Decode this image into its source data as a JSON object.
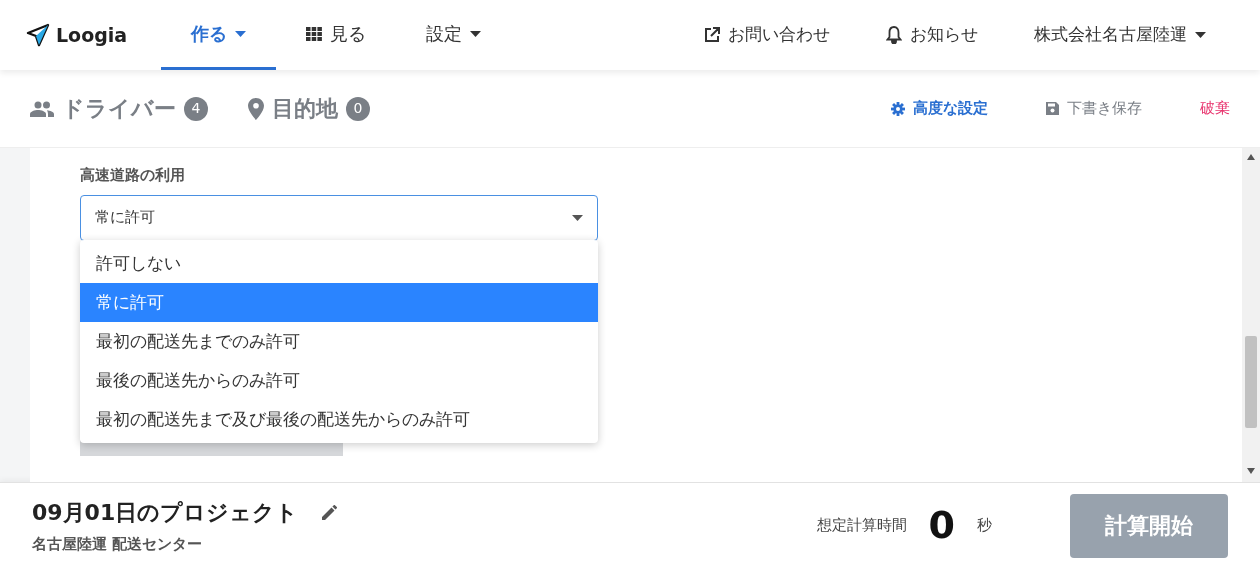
{
  "navbar": {
    "logo": "Loogia",
    "menu": [
      {
        "label": "作る",
        "kind": "dropdown",
        "selected": true
      },
      {
        "label": "見る",
        "kind": "grid",
        "selected": false
      },
      {
        "label": "設定",
        "kind": "dropdown",
        "selected": false
      }
    ],
    "links": [
      {
        "label": "お問い合わせ",
        "kind": "external"
      },
      {
        "label": "お知らせ",
        "kind": "bell"
      },
      {
        "label": "株式会社名古屋陸運",
        "kind": "dropdown"
      }
    ]
  },
  "subheader": {
    "tabs": [
      {
        "label": "ドライバー",
        "count": "4",
        "kind": "people"
      },
      {
        "label": "目的地",
        "count": "0",
        "kind": "pin"
      }
    ],
    "actions": [
      {
        "label": "高度な設定",
        "kind": "settings"
      },
      {
        "label": "下書き保存",
        "kind": "save"
      },
      {
        "label": "破棄",
        "kind": "discard"
      }
    ]
  },
  "form": {
    "label": "高速道路の利用",
    "value": "常に許可",
    "options": [
      {
        "label": "許可しない",
        "selected": false
      },
      {
        "label": "常に許可",
        "selected": true
      },
      {
        "label": "最初の配送先までのみ許可",
        "selected": false
      },
      {
        "label": "最後の配送先からのみ許可",
        "selected": false
      },
      {
        "label": "最初の配送先まで及び最後の配送先からのみ許可",
        "selected": false
      }
    ]
  },
  "footer": {
    "title": "09月01日のプロジェクト",
    "subtitle": "名古屋陸運 配送センター",
    "estimate_label": "計算時間",
    "estimate_prefix": "想定",
    "estimate_value": "0",
    "estimate_unit": "秒",
    "button": {
      "label": "計算開始",
      "disabled": true
    }
  }
}
